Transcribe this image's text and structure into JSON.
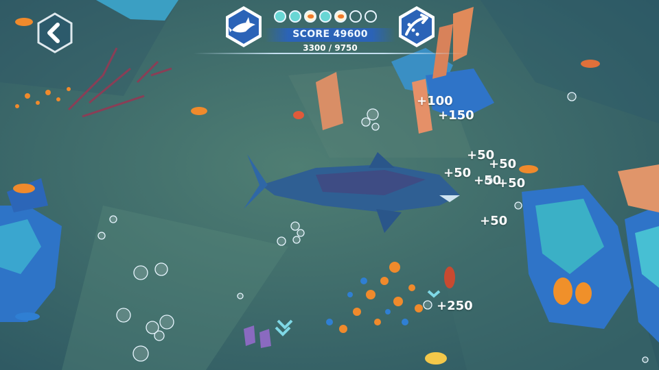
{
  "hud": {
    "score_label": "SCORE 49600",
    "progress_label": "3300 / 9750",
    "left_badge_icon": "dolphin-icon",
    "right_badge_icon": "dolphin-leap-icon",
    "back_icon": "back-arrow-icon",
    "collection_pips": [
      "filled",
      "filled",
      "fish",
      "filled",
      "fish",
      "empty",
      "empty"
    ]
  },
  "score_popups": [
    {
      "id": "p1",
      "text": "+100"
    },
    {
      "id": "p2",
      "text": "+150"
    },
    {
      "id": "p3",
      "text": "+50"
    },
    {
      "id": "p4",
      "text": "+50"
    },
    {
      "id": "p5",
      "text": "+50"
    },
    {
      "id": "p6",
      "text": "+50"
    },
    {
      "id": "p7",
      "text": "+50"
    },
    {
      "id": "p8",
      "text": "+50"
    },
    {
      "id": "p9",
      "text": "+250"
    }
  ],
  "colors": {
    "water": "#3d6a6b",
    "dolphin": "#2f5f93",
    "hud_blue": "#2b63b7",
    "hud_ring": "#ffffff",
    "coral_teal": "#3bb0c6",
    "coral_blue": "#2f74c8",
    "orange_fish": "#f08a2c",
    "pip_teal": "#68d6d4"
  }
}
